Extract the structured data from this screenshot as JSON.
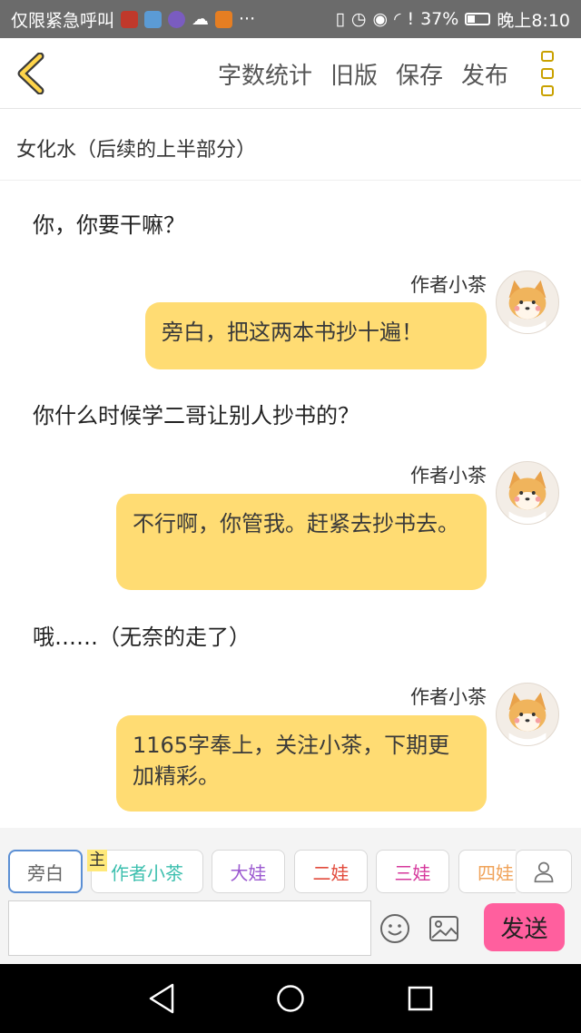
{
  "status_bar": {
    "carrier": "仅限紧急呼叫",
    "more": "···",
    "battery": "37%",
    "time": "晚上8:10"
  },
  "toolbar": {
    "actions": [
      "字数统计",
      "旧版",
      "保存",
      "发布"
    ]
  },
  "document": {
    "title": "女化水（后续的上半部分）"
  },
  "messages": [
    {
      "type": "narration",
      "text": "你，你要干嘛？"
    },
    {
      "type": "speech",
      "speaker": "作者小茶",
      "text": "旁白，把这两本书抄十遍！"
    },
    {
      "type": "narration",
      "text": "你什么时候学二哥让别人抄书的？"
    },
    {
      "type": "speech",
      "speaker": "作者小茶",
      "text": "不行啊，你管我。赶紧去抄书去。"
    },
    {
      "type": "narration",
      "text": "哦……（无奈的走了）"
    },
    {
      "type": "speech",
      "speaker": "作者小茶",
      "text": "1165字奉上，关注小茶，下期更加精彩。"
    }
  ],
  "roles": {
    "main_tag": "主",
    "items": [
      {
        "label": "旁白",
        "color": "#666666"
      },
      {
        "label": "作者小茶",
        "color": "#3cbfae"
      },
      {
        "label": "大娃",
        "color": "#9b59d0"
      },
      {
        "label": "二娃",
        "color": "#e24a3b"
      },
      {
        "label": "三娃",
        "color": "#d6389c"
      },
      {
        "label": "四娃",
        "color": "#f0a35a"
      }
    ]
  },
  "composer": {
    "input_value": "",
    "send_label": "发送"
  },
  "colors": {
    "accent": "#c9a100",
    "bubble": "#ffdc73",
    "send": "#ff5f9e"
  }
}
